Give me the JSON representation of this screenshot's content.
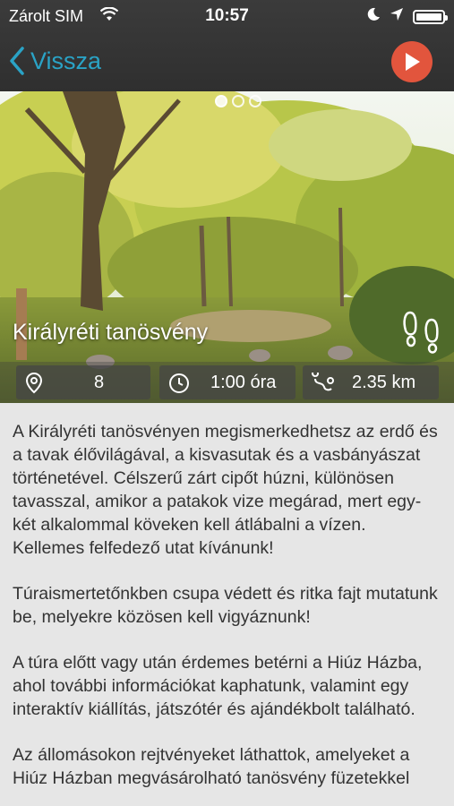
{
  "status_bar": {
    "carrier": "Zárolt SIM",
    "time": "10:57",
    "icons": [
      "wifi-icon",
      "moon-icon",
      "location-arrow-icon",
      "battery-icon"
    ]
  },
  "nav": {
    "back_label": "Vissza",
    "back_icon": "chevron-left-icon",
    "play_icon": "play-icon",
    "accent_color": "#2aa3c6",
    "play_color": "#e2553d"
  },
  "hero": {
    "title": "Királyréti tanösvény",
    "icon": "footprints-icon",
    "stations": "8",
    "duration": "1:00 óra",
    "distance": "2.35 km",
    "stations_icon": "map-pin-icon",
    "duration_icon": "clock-icon",
    "distance_icon": "route-icon"
  },
  "content": {
    "paragraphs": [
      "A Királyréti tanösvényen megismerkedhetsz az erdő és a tavak élővilágával, a kisvasutak és a vasbányászat történetével. Célszerű zárt cipőt húzni, különösen tavasszal, amikor a patakok vize megárad, mert egy-két alkalommal köveken kell átlábalni a vízen. Kellemes felfedező utat kívánunk!",
      "Túraismertetőnkben csupa védett és ritka fajt mutatunk be, melyekre közösen kell vigyáznunk!",
      "A túra előtt vagy után érdemes betérni a Hiúz Házba, ahol további információkat kaphatunk, valamint egy interaktív kiállítás, játszótér és ajándékbolt található.",
      "Az állomásokon rejtvényeket láthattok, amelyeket a Hiúz Házban megvásárolható tanösvény füzetekkel"
    ]
  }
}
